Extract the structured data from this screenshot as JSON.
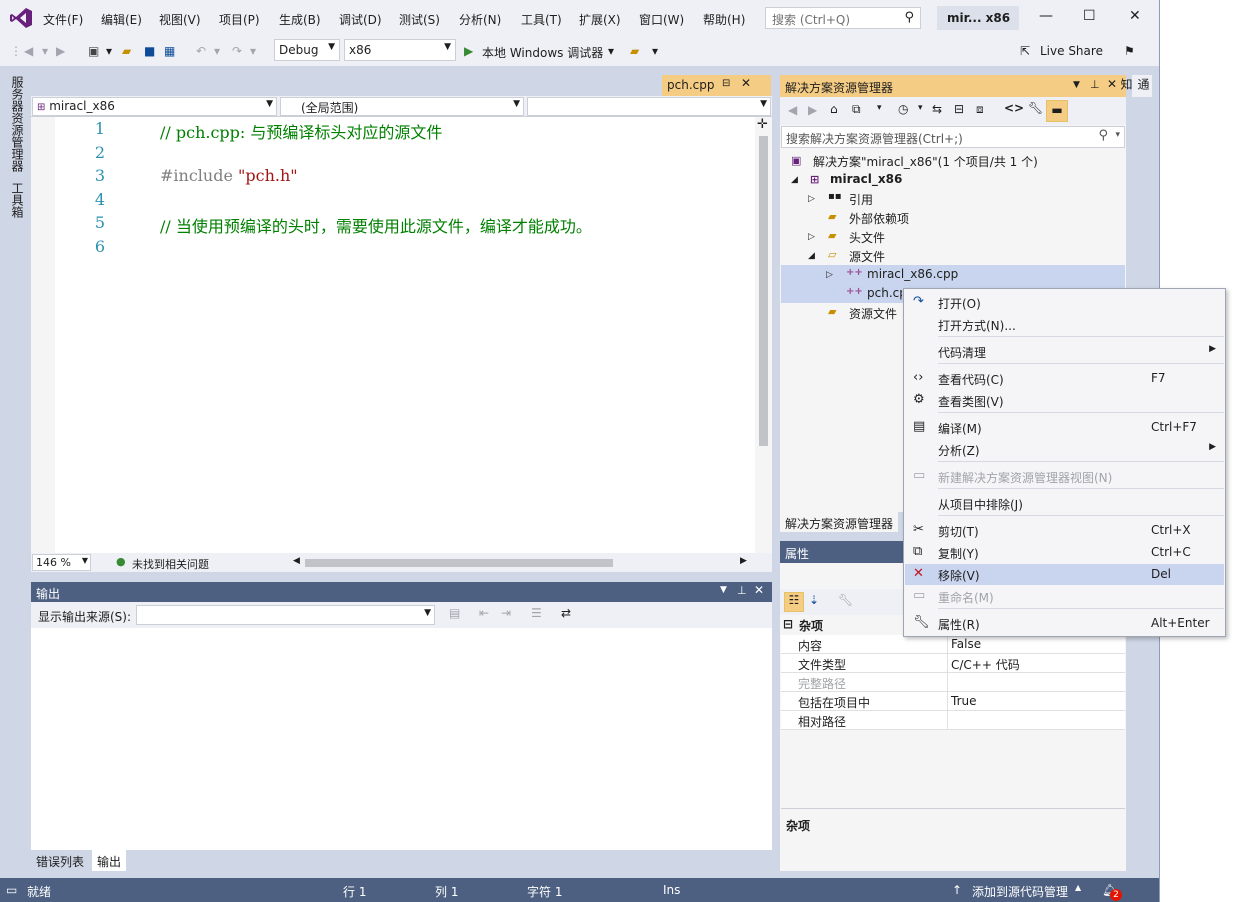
{
  "menubar": {
    "items": [
      "文件(F)",
      "编辑(E)",
      "视图(V)",
      "项目(P)",
      "生成(B)",
      "调试(D)",
      "测试(S)",
      "分析(N)",
      "工具(T)",
      "扩展(X)",
      "窗口(W)",
      "帮助(H)"
    ],
    "search_placeholder": "搜索 (Ctrl+Q)",
    "project_title": "mir... x86"
  },
  "toolbar": {
    "config": "Debug",
    "platform": "x86",
    "run_label": "本地 Windows 调试器",
    "live_share": "Live Share"
  },
  "left_tabs": [
    "服务器资源管理器",
    "工具箱"
  ],
  "editor": {
    "tab": "pch.cpp",
    "nav_project": "miracl_x86",
    "nav_scope": "(全局范围)",
    "lines": [
      {
        "num": "1",
        "parts": [
          {
            "t": "// pch.cpp: 与预编译标头对应的源文件",
            "c": "cmt"
          }
        ]
      },
      {
        "num": "2",
        "parts": []
      },
      {
        "num": "3",
        "parts": [
          {
            "t": "#include ",
            "c": "pre"
          },
          {
            "t": "\"pch.h\"",
            "c": "str"
          }
        ]
      },
      {
        "num": "4",
        "parts": []
      },
      {
        "num": "5",
        "parts": [
          {
            "t": "// 当使用预编译的头时，需要使用此源文件，编译才能成功。",
            "c": "cmt"
          }
        ]
      },
      {
        "num": "6",
        "parts": []
      }
    ],
    "zoom": "146 %",
    "issues": "未找到相关问题"
  },
  "output": {
    "title": "输出",
    "source_label": "显示输出来源(S):",
    "tabs": [
      "错误列表",
      "输出"
    ]
  },
  "solution_explorer": {
    "title": "解决方案资源管理器",
    "search_placeholder": "搜索解决方案资源管理器(Ctrl+;)",
    "tab_label": "解决方案资源管理器",
    "tree": {
      "solution": "解决方案\"miracl_x86\"(1 个项目/共 1 个)",
      "project": "miracl_x86",
      "refs": "引用",
      "ext_deps": "外部依赖项",
      "headers": "头文件",
      "sources": "源文件",
      "file1": "miracl_x86.cpp",
      "file2": "pch.cpp",
      "resources": "资源文件"
    }
  },
  "properties": {
    "title": "属性",
    "category": "杂项",
    "rows": [
      {
        "name": "内容",
        "value": "False",
        "dim": false
      },
      {
        "name": "文件类型",
        "value": "C/C++ 代码",
        "dim": false
      },
      {
        "name": "完整路径",
        "value": "",
        "dim": true
      },
      {
        "name": "包括在项目中",
        "value": "True",
        "dim": false
      },
      {
        "name": "相对路径",
        "value": "",
        "dim": false
      }
    ],
    "desc_title": "杂项"
  },
  "context_menu": {
    "items": [
      {
        "label": "打开(O)",
        "shortcut": "",
        "icon": "open-icon",
        "disabled": false
      },
      {
        "label": "打开方式(N)...",
        "shortcut": "",
        "icon": "",
        "disabled": false
      },
      {
        "label": "代码清理",
        "shortcut": "",
        "icon": "",
        "disabled": false,
        "submenu": true
      },
      {
        "label": "查看代码(C)",
        "shortcut": "F7",
        "icon": "code-icon",
        "disabled": false
      },
      {
        "label": "查看类图(V)",
        "shortcut": "",
        "icon": "class-diagram-icon",
        "disabled": false
      },
      {
        "label": "编译(M)",
        "shortcut": "Ctrl+F7",
        "icon": "compile-icon",
        "disabled": false
      },
      {
        "label": "分析(Z)",
        "shortcut": "",
        "icon": "",
        "disabled": false,
        "submenu": true
      },
      {
        "label": "新建解决方案资源管理器视图(N)",
        "shortcut": "",
        "icon": "new-view-icon",
        "disabled": true
      },
      {
        "label": "从项目中排除(J)",
        "shortcut": "",
        "icon": "",
        "disabled": false
      },
      {
        "label": "剪切(T)",
        "shortcut": "Ctrl+X",
        "icon": "cut-icon",
        "disabled": false
      },
      {
        "label": "复制(Y)",
        "shortcut": "Ctrl+C",
        "icon": "copy-icon",
        "disabled": false
      },
      {
        "label": "移除(V)",
        "shortcut": "Del",
        "icon": "delete-icon",
        "disabled": false,
        "highlighted": true
      },
      {
        "label": "重命名(M)",
        "shortcut": "",
        "icon": "rename-icon",
        "disabled": true
      },
      {
        "label": "属性(R)",
        "shortcut": "Alt+Enter",
        "icon": "wrench-icon",
        "disabled": false
      }
    ]
  },
  "statusbar": {
    "ready": "就绪",
    "line": "行 1",
    "col": "列 1",
    "char": "字符 1",
    "ins": "Ins",
    "source_control": "添加到源代码管理",
    "notifications": "2"
  },
  "notify_tab": "通知",
  "colors": {
    "accent": "#4d6082",
    "active_tab": "#f5cc84",
    "comment": "#008000",
    "string": "#a31515",
    "line_number": "#2b91af"
  }
}
